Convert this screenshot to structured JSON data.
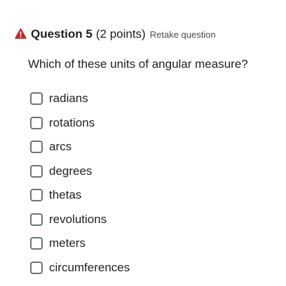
{
  "question": {
    "number_label": "Question 5",
    "points_label": "(2 points)",
    "retake_label": "Retake question",
    "warning_color": "#cd2026",
    "prompt": "Which of these units of angular measure?"
  },
  "options": [
    {
      "label": "radians",
      "checked": false
    },
    {
      "label": "rotations",
      "checked": false
    },
    {
      "label": "arcs",
      "checked": false
    },
    {
      "label": "degrees",
      "checked": false
    },
    {
      "label": "thetas",
      "checked": false
    },
    {
      "label": "revolutions",
      "checked": false
    },
    {
      "label": "meters",
      "checked": false
    },
    {
      "label": "circumferences",
      "checked": false
    }
  ]
}
